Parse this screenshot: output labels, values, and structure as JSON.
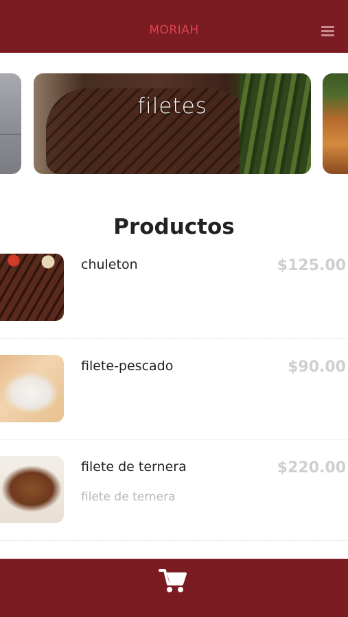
{
  "header": {
    "title": "MORIAH",
    "menu_icon": "hamburger-menu-icon"
  },
  "carousel": {
    "active_title": "filetes"
  },
  "products": {
    "heading": "Productos",
    "items": [
      {
        "name": "chuleton",
        "price": "$125.00",
        "description": ""
      },
      {
        "name": "filete-pescado",
        "price": "$90.00",
        "description": ""
      },
      {
        "name": "filete de ternera",
        "price": "$220.00",
        "description": "filete de ternera"
      }
    ]
  },
  "footer": {
    "cart_icon": "shopping-cart-icon"
  },
  "colors": {
    "brand": "#7b1c22",
    "brand_text": "#e0424f",
    "price_text": "#cfcfcf"
  }
}
